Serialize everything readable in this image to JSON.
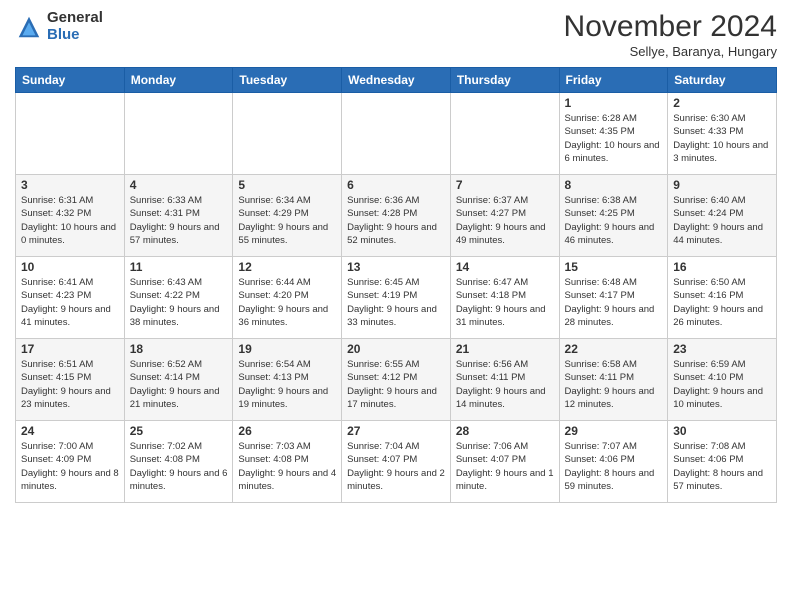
{
  "logo": {
    "general": "General",
    "blue": "Blue"
  },
  "header": {
    "title": "November 2024",
    "location": "Sellye, Baranya, Hungary"
  },
  "weekdays": [
    "Sunday",
    "Monday",
    "Tuesday",
    "Wednesday",
    "Thursday",
    "Friday",
    "Saturday"
  ],
  "weeks": [
    [
      {
        "day": "",
        "sunrise": "",
        "sunset": "",
        "daylight": ""
      },
      {
        "day": "",
        "sunrise": "",
        "sunset": "",
        "daylight": ""
      },
      {
        "day": "",
        "sunrise": "",
        "sunset": "",
        "daylight": ""
      },
      {
        "day": "",
        "sunrise": "",
        "sunset": "",
        "daylight": ""
      },
      {
        "day": "",
        "sunrise": "",
        "sunset": "",
        "daylight": ""
      },
      {
        "day": "1",
        "sunrise": "Sunrise: 6:28 AM",
        "sunset": "Sunset: 4:35 PM",
        "daylight": "Daylight: 10 hours and 6 minutes."
      },
      {
        "day": "2",
        "sunrise": "Sunrise: 6:30 AM",
        "sunset": "Sunset: 4:33 PM",
        "daylight": "Daylight: 10 hours and 3 minutes."
      }
    ],
    [
      {
        "day": "3",
        "sunrise": "Sunrise: 6:31 AM",
        "sunset": "Sunset: 4:32 PM",
        "daylight": "Daylight: 10 hours and 0 minutes."
      },
      {
        "day": "4",
        "sunrise": "Sunrise: 6:33 AM",
        "sunset": "Sunset: 4:31 PM",
        "daylight": "Daylight: 9 hours and 57 minutes."
      },
      {
        "day": "5",
        "sunrise": "Sunrise: 6:34 AM",
        "sunset": "Sunset: 4:29 PM",
        "daylight": "Daylight: 9 hours and 55 minutes."
      },
      {
        "day": "6",
        "sunrise": "Sunrise: 6:36 AM",
        "sunset": "Sunset: 4:28 PM",
        "daylight": "Daylight: 9 hours and 52 minutes."
      },
      {
        "day": "7",
        "sunrise": "Sunrise: 6:37 AM",
        "sunset": "Sunset: 4:27 PM",
        "daylight": "Daylight: 9 hours and 49 minutes."
      },
      {
        "day": "8",
        "sunrise": "Sunrise: 6:38 AM",
        "sunset": "Sunset: 4:25 PM",
        "daylight": "Daylight: 9 hours and 46 minutes."
      },
      {
        "day": "9",
        "sunrise": "Sunrise: 6:40 AM",
        "sunset": "Sunset: 4:24 PM",
        "daylight": "Daylight: 9 hours and 44 minutes."
      }
    ],
    [
      {
        "day": "10",
        "sunrise": "Sunrise: 6:41 AM",
        "sunset": "Sunset: 4:23 PM",
        "daylight": "Daylight: 9 hours and 41 minutes."
      },
      {
        "day": "11",
        "sunrise": "Sunrise: 6:43 AM",
        "sunset": "Sunset: 4:22 PM",
        "daylight": "Daylight: 9 hours and 38 minutes."
      },
      {
        "day": "12",
        "sunrise": "Sunrise: 6:44 AM",
        "sunset": "Sunset: 4:20 PM",
        "daylight": "Daylight: 9 hours and 36 minutes."
      },
      {
        "day": "13",
        "sunrise": "Sunrise: 6:45 AM",
        "sunset": "Sunset: 4:19 PM",
        "daylight": "Daylight: 9 hours and 33 minutes."
      },
      {
        "day": "14",
        "sunrise": "Sunrise: 6:47 AM",
        "sunset": "Sunset: 4:18 PM",
        "daylight": "Daylight: 9 hours and 31 minutes."
      },
      {
        "day": "15",
        "sunrise": "Sunrise: 6:48 AM",
        "sunset": "Sunset: 4:17 PM",
        "daylight": "Daylight: 9 hours and 28 minutes."
      },
      {
        "day": "16",
        "sunrise": "Sunrise: 6:50 AM",
        "sunset": "Sunset: 4:16 PM",
        "daylight": "Daylight: 9 hours and 26 minutes."
      }
    ],
    [
      {
        "day": "17",
        "sunrise": "Sunrise: 6:51 AM",
        "sunset": "Sunset: 4:15 PM",
        "daylight": "Daylight: 9 hours and 23 minutes."
      },
      {
        "day": "18",
        "sunrise": "Sunrise: 6:52 AM",
        "sunset": "Sunset: 4:14 PM",
        "daylight": "Daylight: 9 hours and 21 minutes."
      },
      {
        "day": "19",
        "sunrise": "Sunrise: 6:54 AM",
        "sunset": "Sunset: 4:13 PM",
        "daylight": "Daylight: 9 hours and 19 minutes."
      },
      {
        "day": "20",
        "sunrise": "Sunrise: 6:55 AM",
        "sunset": "Sunset: 4:12 PM",
        "daylight": "Daylight: 9 hours and 17 minutes."
      },
      {
        "day": "21",
        "sunrise": "Sunrise: 6:56 AM",
        "sunset": "Sunset: 4:11 PM",
        "daylight": "Daylight: 9 hours and 14 minutes."
      },
      {
        "day": "22",
        "sunrise": "Sunrise: 6:58 AM",
        "sunset": "Sunset: 4:11 PM",
        "daylight": "Daylight: 9 hours and 12 minutes."
      },
      {
        "day": "23",
        "sunrise": "Sunrise: 6:59 AM",
        "sunset": "Sunset: 4:10 PM",
        "daylight": "Daylight: 9 hours and 10 minutes."
      }
    ],
    [
      {
        "day": "24",
        "sunrise": "Sunrise: 7:00 AM",
        "sunset": "Sunset: 4:09 PM",
        "daylight": "Daylight: 9 hours and 8 minutes."
      },
      {
        "day": "25",
        "sunrise": "Sunrise: 7:02 AM",
        "sunset": "Sunset: 4:08 PM",
        "daylight": "Daylight: 9 hours and 6 minutes."
      },
      {
        "day": "26",
        "sunrise": "Sunrise: 7:03 AM",
        "sunset": "Sunset: 4:08 PM",
        "daylight": "Daylight: 9 hours and 4 minutes."
      },
      {
        "day": "27",
        "sunrise": "Sunrise: 7:04 AM",
        "sunset": "Sunset: 4:07 PM",
        "daylight": "Daylight: 9 hours and 2 minutes."
      },
      {
        "day": "28",
        "sunrise": "Sunrise: 7:06 AM",
        "sunset": "Sunset: 4:07 PM",
        "daylight": "Daylight: 9 hours and 1 minute."
      },
      {
        "day": "29",
        "sunrise": "Sunrise: 7:07 AM",
        "sunset": "Sunset: 4:06 PM",
        "daylight": "Daylight: 8 hours and 59 minutes."
      },
      {
        "day": "30",
        "sunrise": "Sunrise: 7:08 AM",
        "sunset": "Sunset: 4:06 PM",
        "daylight": "Daylight: 8 hours and 57 minutes."
      }
    ]
  ]
}
